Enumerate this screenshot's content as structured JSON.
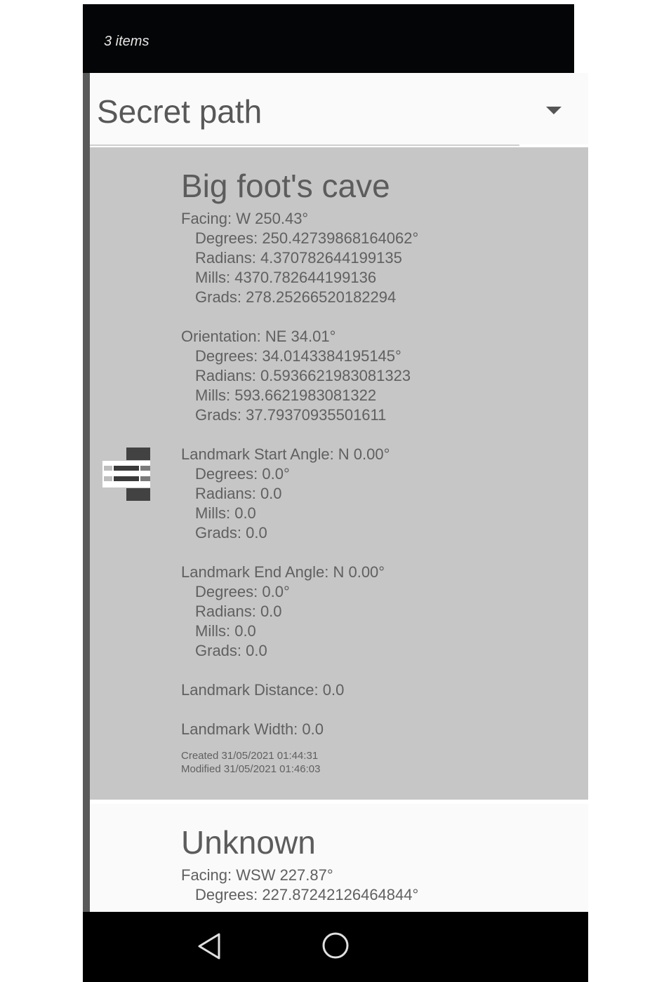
{
  "status_bar": {
    "text": "3 items"
  },
  "spinner": {
    "selected_value": "Secret path"
  },
  "items": [
    {
      "title": "Big foot's cave",
      "facing": {
        "label": "Facing: W 250.43°",
        "degrees": "Degrees: 250.42739868164062°",
        "radians": "Radians: 4.370782644199135",
        "mills": "Mills: 4370.782644199136",
        "grads": "Grads: 278.25266520182294"
      },
      "orientation": {
        "label": "Orientation: NE 34.01°",
        "degrees": "Degrees: 34.0143384195145°",
        "radians": "Radians: 0.5936621983081323",
        "mills": "Mills: 593.6621983081322",
        "grads": "Grads: 37.79370935501611"
      },
      "start_angle": {
        "label": "Landmark Start Angle: N 0.00°",
        "degrees": "Degrees: 0.0°",
        "radians": "Radians: 0.0",
        "mills": "Mills: 0.0",
        "grads": "Grads: 0.0"
      },
      "end_angle": {
        "label": "Landmark End Angle: N 0.00°",
        "degrees": "Degrees: 0.0°",
        "radians": "Radians: 0.0",
        "mills": "Mills: 0.0",
        "grads": "Grads: 0.0"
      },
      "distance": "Landmark Distance: 0.0",
      "width": "Landmark Width: 0.0",
      "created": "Created 31/05/2021 01:44:31",
      "modified": "Modified 31/05/2021 01:46:03",
      "icon": "drag-reorder-icon"
    },
    {
      "title": "Unknown",
      "facing": {
        "label": "Facing: WSW 227.87°",
        "degrees": "Degrees: 227.87242126464844°"
      }
    }
  ],
  "nav": {
    "back_icon": "back-triangle-icon",
    "home_icon": "home-circle-icon"
  },
  "colors": {
    "status_bar": "#040506",
    "selected_card": "#c6c6c6",
    "text": "#606060"
  }
}
